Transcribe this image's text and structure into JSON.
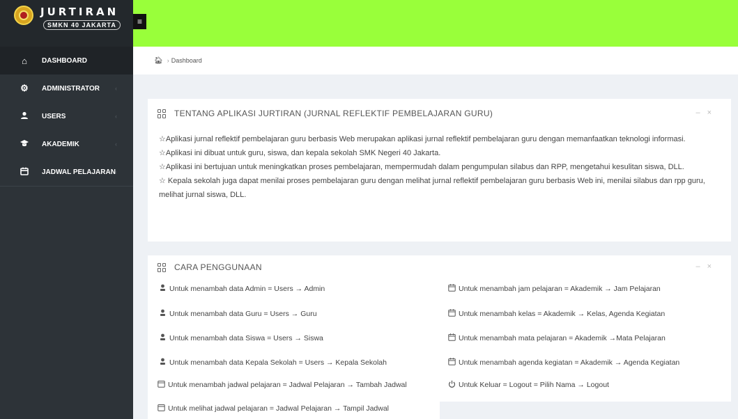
{
  "brand": {
    "title": "JURTIRAN",
    "subtitle": "SMKN 40 JAKARTA"
  },
  "sidebar": {
    "items": [
      {
        "label": "DASHBOARD",
        "icon": "home-icon"
      },
      {
        "label": "ADMINISTRATOR",
        "icon": "gear-icon"
      },
      {
        "label": "USERS",
        "icon": "users-icon"
      },
      {
        "label": "AKADEMIK",
        "icon": "graduation-cap-icon"
      },
      {
        "label": "JADWAL PELAJARAN",
        "icon": "calendar-icon"
      }
    ],
    "caret": "‹"
  },
  "topbar": {
    "toggle_glyph": "≡"
  },
  "breadcrumb": {
    "current": "Dashboard"
  },
  "about": {
    "title": "TENTANG APLIKASI JURTIRAN (JURNAL REFLEKTIF PEMBELAJARAN GURU)",
    "lines": [
      "☆Aplikasi jurnal reflektif pembelajaran guru berbasis Web merupakan aplikasi jurnal reflektif pembelajaran guru dengan memanfaatkan teknologi informasi.",
      "☆Aplikasi ini dibuat untuk guru, siswa, dan kepala sekolah SMK Negeri 40 Jakarta.",
      "☆Aplikasi ini bertujuan untuk meningkatkan proses pembelajaran, mempermudah dalam pengumpulan silabus dan RPP, mengetahui kesulitan siswa, DLL.",
      "☆ Kepala sekolah juga dapat menilai proses pembelajaran guru dengan melihat jurnal reflektif pembelajaran guru berbasis Web ini, menilai silabus dan rpp guru, melihat jurnal siswa, DLL."
    ]
  },
  "howto": {
    "title": "CARA PENGGUNAAN",
    "left": [
      "Untuk menambah data Admin = Users → Admin",
      "Untuk menambah data Guru = Users → Guru",
      "Untuk menambah data Siswa = Users → Siswa",
      "Untuk menambah data Kepala Sekolah = Users → Kepala Sekolah",
      "Untuk menambah jadwal pelajaran = Jadwal Pelajaran → Tambah Jadwal",
      "Untuk melihat jadwal pelajaran = Jadwal Pelajaran → Tampil Jadwal"
    ],
    "right": [
      "Untuk menambah jam pelajaran = Akademik → Jam Pelajaran",
      "Untuk menambah kelas = Akademik → Kelas, Agenda Kegiatan",
      "Untuk menambah mata pelajaran = Akademik →Mata Pelajaran",
      "Untuk menambah agenda kegiatan = Akademik → Agenda Kegiatan",
      "Untuk Keluar = Logout = Pilih Nama → Logout"
    ]
  },
  "panel_tools": {
    "minimize": "–",
    "close": "×"
  }
}
